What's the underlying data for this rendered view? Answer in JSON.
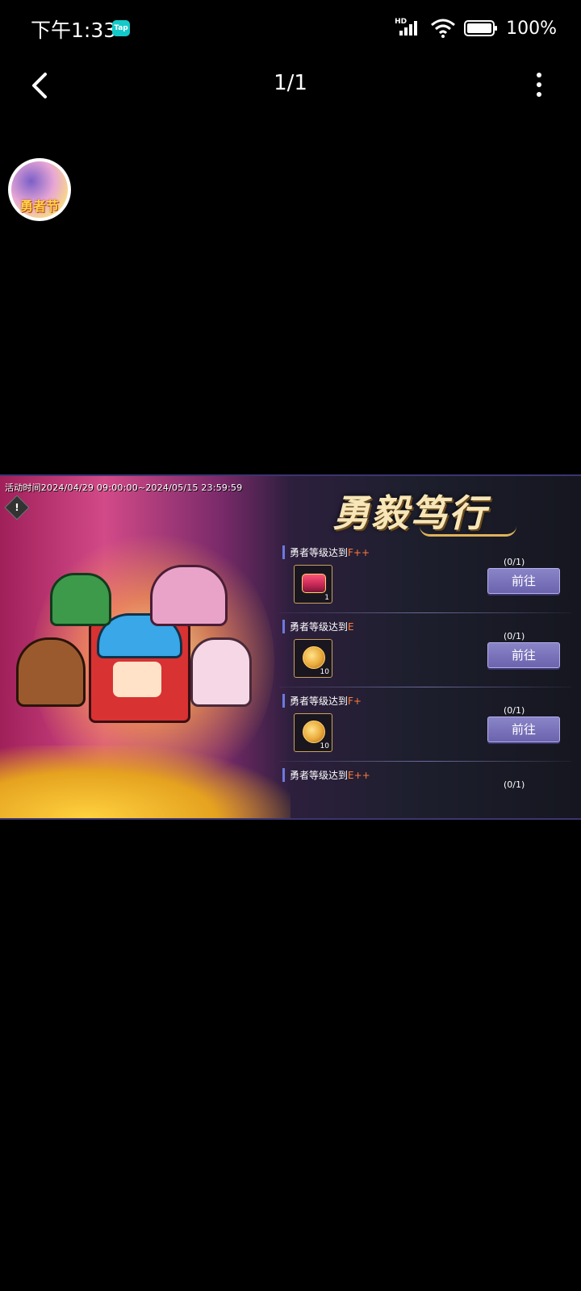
{
  "status_bar": {
    "time": "下午1:33",
    "tap_badge": "Tap",
    "network": "HD",
    "battery": "100%"
  },
  "nav": {
    "page_counter": "1/1"
  },
  "avatar": {
    "text": "勇者节"
  },
  "game": {
    "event_time": "活动时间2024/04/29 09:00:00~2024/05/15 23:59:59",
    "info_icon": "!",
    "title": "勇毅笃行",
    "tasks": [
      {
        "label_prefix": "勇者等级达到",
        "level": "F++",
        "progress": "(0/1)",
        "reward_qty": "1",
        "button": "前往"
      },
      {
        "label_prefix": "勇者等级达到",
        "level": "E",
        "progress": "(0/1)",
        "reward_qty": "10",
        "button": "前往"
      },
      {
        "label_prefix": "勇者等级达到",
        "level": "F+",
        "progress": "(0/1)",
        "reward_qty": "10",
        "button": "前往"
      },
      {
        "label_prefix": "勇者等级达到",
        "level": "E++",
        "progress": "(0/1)",
        "reward_qty": "",
        "button": ""
      }
    ]
  },
  "colors": {
    "accent": "#6c64ae",
    "level_text": "#ff7a3a",
    "title_text": "#f6e6b8"
  }
}
